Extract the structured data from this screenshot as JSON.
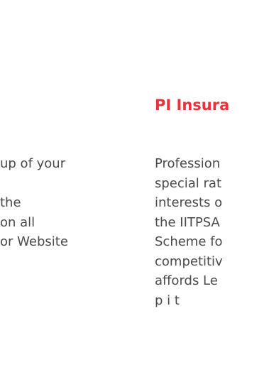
{
  "left_column": {
    "lines": [
      "up of your",
      "",
      "the",
      "on all",
      "or Website"
    ]
  },
  "right_column": {
    "heading": "PI Insura",
    "lines": [
      "Profession",
      "special rat",
      "interests o",
      "the IITPSA",
      "Scheme fo",
      "competitiv",
      "affords Le",
      "p  i t"
    ]
  },
  "colors": {
    "heading": "#e8333c",
    "body_text": "#4a4a4a",
    "background": "#ffffff"
  }
}
